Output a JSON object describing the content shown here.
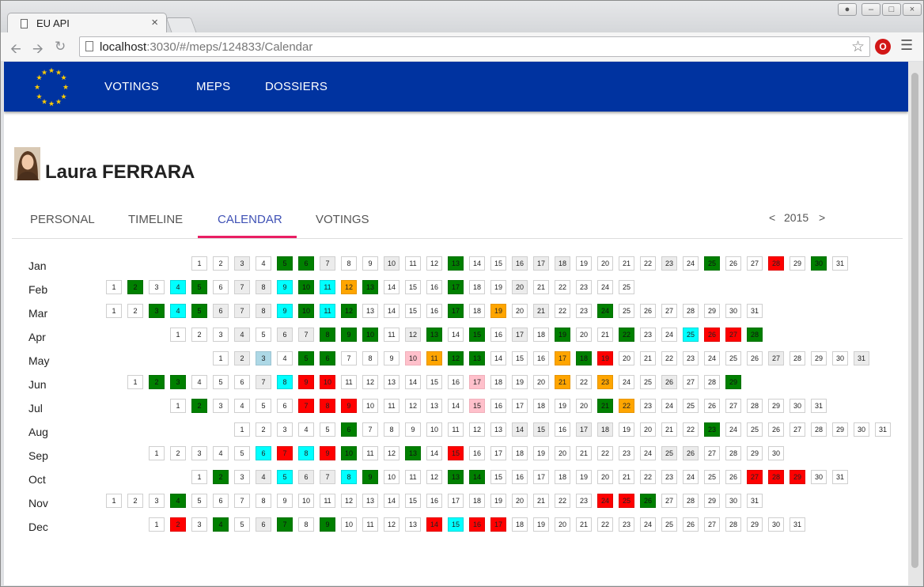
{
  "browser": {
    "tab_title": "EU API",
    "tab_close": "×",
    "url_host": "localhost",
    "url_rest": ":3030/#/meps/124833/Calendar"
  },
  "nav": {
    "items": [
      "VOTINGS",
      "MEPS",
      "DOSSIERS"
    ]
  },
  "profile": {
    "name": "Laura FERRARA"
  },
  "tabs": [
    "PERSONAL",
    "TIMELINE",
    "CALENDAR",
    "VOTINGS"
  ],
  "active_tab": "CALENDAR",
  "year": {
    "prev": "<",
    "value": "2015",
    "next": ">"
  },
  "calendar_legend": {
    "e": "#ececec",
    "g": "#008000",
    "c": "#00ffff",
    "r": "#ff0000",
    "o": "#ffa500",
    "p": "#ffc0cb",
    "b": "#add8e6"
  },
  "calendar": [
    {
      "month": "Jan",
      "first_weekday": 4,
      "days": "wwewggewwewwgwweeewwwwewgwwrwgw"
    },
    {
      "month": "Feb",
      "first_weekday": 0,
      "days": "wgwcgweecgcogwwwgwwewwwww"
    },
    {
      "month": "Mar",
      "first_weekday": 0,
      "days": "wwgcgeeecgcgwwwwgwowewwgwwwwwww"
    },
    {
      "month": "Apr",
      "first_weekday": 3,
      "days": "wwweweegggwegwgwewgwwgwwcrrg"
    },
    {
      "month": "May",
      "first_weekday": 5,
      "days": "webwggwwwpoggwwwogrwwwwwwwewwwe"
    },
    {
      "month": "Jun",
      "first_weekday": 1,
      "days": "wggwwwecrrwwwwwwpwwwowowwewwg"
    },
    {
      "month": "Jul",
      "first_weekday": 3,
      "days": "wgwwwwrrrwwwwwpwwwwwgowwwwwwwww"
    },
    {
      "month": "Aug",
      "first_weekday": 6,
      "days": "wwwwwgwwwwwwweeweewwwwgwwwwwwww"
    },
    {
      "month": "Sep",
      "first_weekday": 2,
      "days": "wwwwwcrcrgwwgwrwwwwwwwwweewwww"
    },
    {
      "month": "Oct",
      "first_weekday": 4,
      "days": "wgweceecgwwwggwwwwwwwwwwwwrrrww"
    },
    {
      "month": "Nov",
      "first_weekday": 0,
      "days": "wwwgwwwwwwwwwwwwwwwwwwwrrgwwwww"
    },
    {
      "month": "Dec",
      "first_weekday": 2,
      "days": "wrwgwegwgwwwwrcrrwwwwwwwwwwwwww"
    }
  ]
}
